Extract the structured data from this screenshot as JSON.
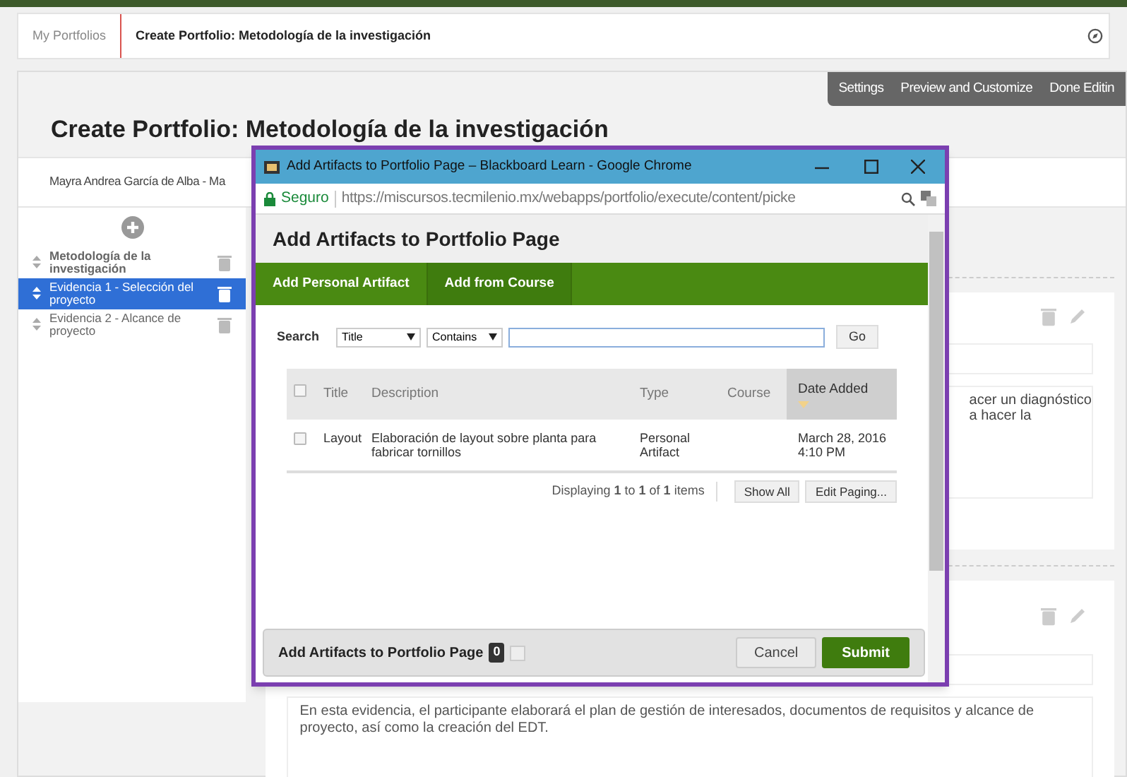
{
  "breadcrumb": [
    {
      "label": "My Portfolios",
      "selected": false
    },
    {
      "label": "Create Portfolio: Metodología de la investigación",
      "selected": true
    }
  ],
  "toolbar": [
    "Settings",
    "Preview and Customize",
    "Done Editin"
  ],
  "page_title": "Create Portfolio: Metodología de la investigación",
  "author": "Mayra Andrea García de Alba - Ma",
  "pages": [
    {
      "label": "Metodología de la investigación",
      "selected": false,
      "kind": "title"
    },
    {
      "label": "Evidencia 1 - Selección del proyecto",
      "selected": true,
      "kind": "page"
    },
    {
      "label": "Evidencia 2 - Alcance de proyecto",
      "selected": false,
      "kind": "page"
    }
  ],
  "card_fragments": [
    "acer un diagnóstico",
    "a hacer la"
  ],
  "card_text": "En esta evidencia, el participante elaborará el plan de gestión de interesados, documentos de requisitos y alcance de proyecto, así como la creación del EDT.",
  "popup": {
    "window_title": "Add Artifacts to Portfolio Page – Blackboard Learn - Google Chrome",
    "secure_label": "Seguro",
    "url": "https://miscursos.tecmilenio.mx/webapps/portfolio/execute/content/picke",
    "heading": "Add Artifacts to Portfolio Page",
    "tabs": [
      {
        "label": "Add Personal Artifact",
        "selected": false
      },
      {
        "label": "Add from Course",
        "selected": true
      }
    ],
    "search": {
      "label": "Search",
      "field": "Title",
      "operator": "Contains",
      "button": "Go"
    },
    "header_checked": false,
    "columns": [
      {
        "label": "Title",
        "sorted": false
      },
      {
        "label": "Description",
        "sorted": false
      },
      {
        "label": "Type",
        "sorted": false
      },
      {
        "label": "Course",
        "sorted": false
      },
      {
        "label": "Date Added",
        "sorted": true
      }
    ],
    "rows": [
      {
        "checked": false,
        "cells": [
          "Layout",
          "Elaboración de layout sobre planta para fabricar tornillos",
          "Personal Artifact",
          "",
          "March 28, 2016 4:10 PM"
        ]
      }
    ],
    "paging": "Displaying **1** to **1** of **1** items",
    "paging_buttons": [
      "Show All",
      "Edit Paging..."
    ],
    "footer_title": "Add Artifacts to Portfolio Page",
    "footer_count": "0",
    "cancel": "Cancel",
    "submit": "Submit"
  }
}
